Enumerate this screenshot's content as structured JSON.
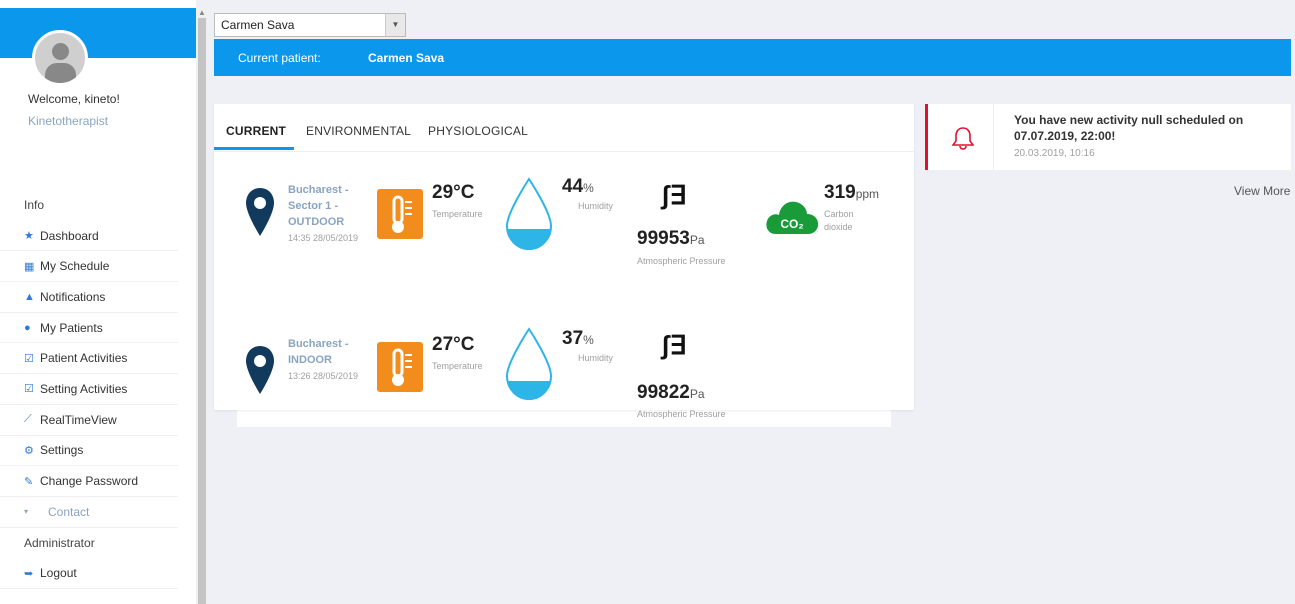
{
  "user": {
    "welcome": "Welcome, kineto!",
    "role": "Kinetotherapist"
  },
  "nav": {
    "info": "Info",
    "items": [
      {
        "label": "Dashboard",
        "icon": "star-icon",
        "glyph": "★"
      },
      {
        "label": "My Schedule",
        "icon": "calendar-icon",
        "glyph": "▦"
      },
      {
        "label": "Notifications",
        "icon": "bell-icon",
        "glyph": "▲"
      },
      {
        "label": "My Patients",
        "icon": "users-icon",
        "glyph": "●"
      },
      {
        "label": "Patient Activities",
        "icon": "checkbox-icon",
        "glyph": "☑"
      },
      {
        "label": "Setting Activities",
        "icon": "checkbox-icon",
        "glyph": "☑"
      },
      {
        "label": "RealTimeView",
        "icon": "chart-line-icon",
        "glyph": "⟋"
      },
      {
        "label": "Settings",
        "icon": "gears-icon",
        "glyph": "⚙"
      },
      {
        "label": "Change Password",
        "icon": "edit-icon",
        "glyph": "✎"
      }
    ],
    "contact": "Contact",
    "administrator": "Administrator",
    "logout": "Logout"
  },
  "patient_select": {
    "value": "Carmen Sava"
  },
  "patient_bar": {
    "label": "Current patient:",
    "name": "Carmen Sava"
  },
  "tabs": [
    "CURRENT",
    "ENVIRONMENTAL",
    "PHYSIOLOGICAL"
  ],
  "readings": [
    {
      "location_lines": [
        "Bucharest -",
        "Sector 1 -",
        "OUTDOOR"
      ],
      "time": "14:35 28/05/2019",
      "temperature": "29°C",
      "temperature_label": "Temperature",
      "humidity": "44",
      "humidity_unit": "%",
      "humidity_label": "Humidity",
      "humidity_level": 0.44,
      "pressure": "99953",
      "pressure_unit": "Pa",
      "pressure_label": "Atmospheric Pressure",
      "co2": "319",
      "co2_unit": "ppm",
      "co2_label_1": "Carbon",
      "co2_label_2": "dioxide",
      "co2_icon_text": "CO₂"
    },
    {
      "location_lines": [
        "Bucharest -",
        "INDOOR"
      ],
      "time": "13:26 28/05/2019",
      "temperature": "27°C",
      "temperature_label": "Temperature",
      "humidity": "37",
      "humidity_unit": "%",
      "humidity_label": "Humidity",
      "humidity_level": 0.37,
      "pressure": "99822",
      "pressure_unit": "Pa",
      "pressure_label": "Atmospheric Pressure"
    }
  ],
  "notification": {
    "message": "You have new activity null scheduled on 07.07.2019, 22:00!",
    "timestamp": "20.03.2019, 10:16"
  },
  "view_more": "View More",
  "colors": {
    "primary": "#0b98ec",
    "alert": "#e0102f",
    "thermo": "#f28c1c",
    "co2": "#1a9b3a",
    "pin": "#123a5c"
  }
}
